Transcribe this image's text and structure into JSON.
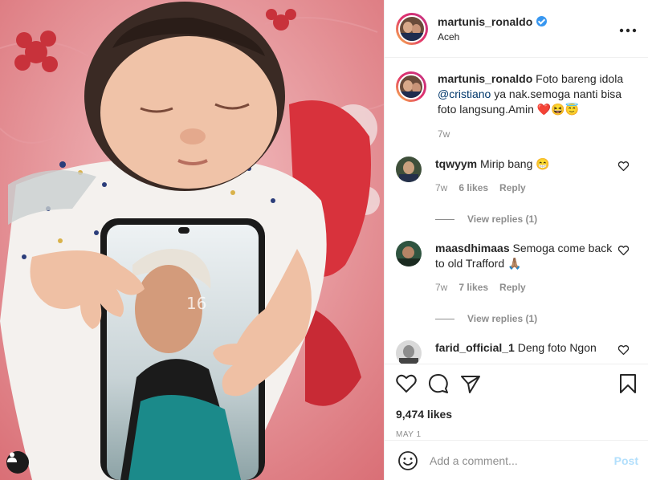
{
  "post": {
    "username": "martunis_ronaldo",
    "location": "Aceh",
    "caption_user": "martunis_ronaldo",
    "caption_pre": "Foto bareng idola ",
    "caption_mention": "@cristiano",
    "caption_post": " ya nak.semoga nanti bisa foto langsung.Amin ❤️😆😇",
    "caption_time": "7w",
    "likes": "9,474 likes",
    "date": "MAY 1"
  },
  "media": {
    "phone_time": "16"
  },
  "comments": [
    {
      "user": "tqwyym",
      "text": "Mirip bang 😁",
      "time": "7w",
      "likes": "6 likes",
      "reply": "Reply",
      "view_replies": "View replies (1)"
    },
    {
      "user": "maasdhimaas",
      "text": "Semoga come back to old Trafford 🙏🏽",
      "time": "7w",
      "likes": "7 likes",
      "reply": "Reply",
      "view_replies": "View replies (1)"
    },
    {
      "user": "farid_official_1",
      "text": "Deng foto Ngon"
    }
  ],
  "composer": {
    "placeholder": "Add a comment...",
    "post_label": "Post"
  },
  "icons": {
    "more": "more-options-icon",
    "like": "heart-icon",
    "comment": "comment-icon",
    "share": "share-icon",
    "save": "bookmark-icon",
    "emoji": "emoji-icon",
    "tag": "user-tag-icon"
  },
  "colors": {
    "verified": "#3897f0",
    "mention": "#00376b",
    "post_button": "#b2dffc",
    "muted": "#8e8e8e"
  }
}
